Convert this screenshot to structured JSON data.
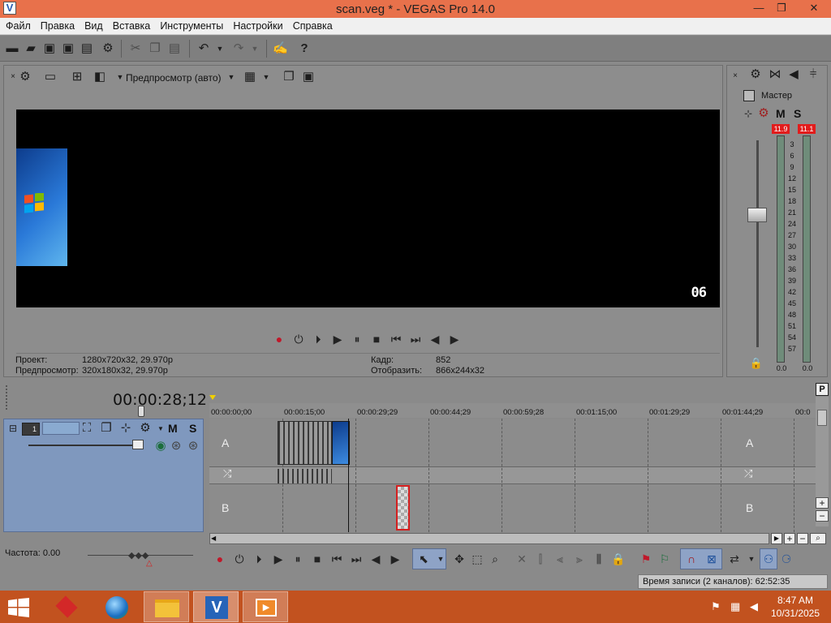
{
  "window": {
    "title": "scan.veg * - VEGAS Pro 14.0",
    "app_icon": "V"
  },
  "window_buttons": {
    "minimize": "—",
    "restore": "❐",
    "close": "✕"
  },
  "menu": [
    "Файл",
    "Правка",
    "Вид",
    "Вставка",
    "Инструменты",
    "Настройки",
    "Справка"
  ],
  "preview": {
    "mode_label": "Предпросмотр (авто)",
    "watermark": "06",
    "project_label": "Проект:",
    "project_value": "1280x720x32, 29.970p",
    "preview_label": "Предпросмотр:",
    "preview_value": "320x180x32, 29.970p",
    "frame_label": "Кадр:",
    "frame_value": "852",
    "display_label": "Отобразить:",
    "display_value": "866x244x32"
  },
  "mixer": {
    "master_label": "Мастер",
    "mute": "M",
    "solo": "S",
    "peak_left": "11.9",
    "peak_right": "11.1",
    "scale": [
      "3",
      "6",
      "9",
      "12",
      "15",
      "18",
      "21",
      "24",
      "27",
      "30",
      "33",
      "36",
      "39",
      "42",
      "45",
      "48",
      "51",
      "54",
      "57"
    ],
    "level_left": "0.0",
    "level_right": "0.0"
  },
  "timeline": {
    "timecode": "00:00:28;12",
    "ruler": [
      "00:00:00;00",
      "00:00:15;00",
      "00:00:29;29",
      "00:00:44;29",
      "00:00:59;28",
      "00:01:15;00",
      "00:01:29;29",
      "00:01:44;29",
      "00:0"
    ],
    "track_number": "1",
    "track_mute": "M",
    "track_solo": "S",
    "lane_a": "A",
    "lane_b": "B",
    "rate_label": "Частота: 0.00"
  },
  "status": {
    "record_time": "Время записи (2 каналов): 62:52:35"
  },
  "taskbar": {
    "time": "8:47 AM",
    "date": "10/31/2025"
  }
}
